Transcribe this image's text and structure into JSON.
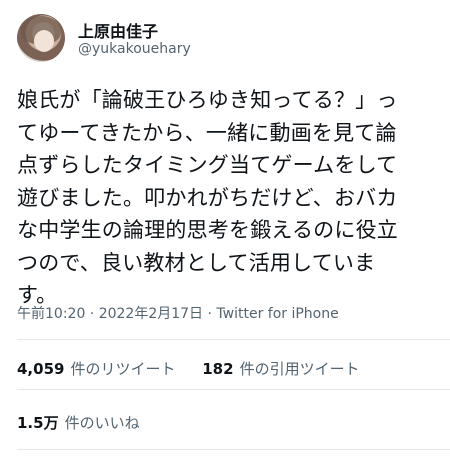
{
  "user": {
    "name": "上原由佳子",
    "handle": "@yukakouehary"
  },
  "tweet": {
    "lines": [
      "娘氏が「論破王ひろゆき知ってる？」っ",
      "てゆーてきたから、一緒に動画を見て論",
      "点ずらしたタイミング当てゲームをして",
      "遊びました。叩かれがちだけど、おバカ",
      "な中学生の論理的思考を鍛えるのに役立",
      "つので、良い教材として活用していま",
      "す。"
    ],
    "meta": "午前10:20 · 2022年2月17日 · Twitter for iPhone"
  },
  "stats": {
    "retweets": {
      "value": "4,059",
      "label": "件のリツイート"
    },
    "quotes": {
      "value": "182",
      "label": "件の引用ツイート"
    },
    "likes": {
      "value": "1.5万",
      "label": "件のいいね"
    }
  }
}
